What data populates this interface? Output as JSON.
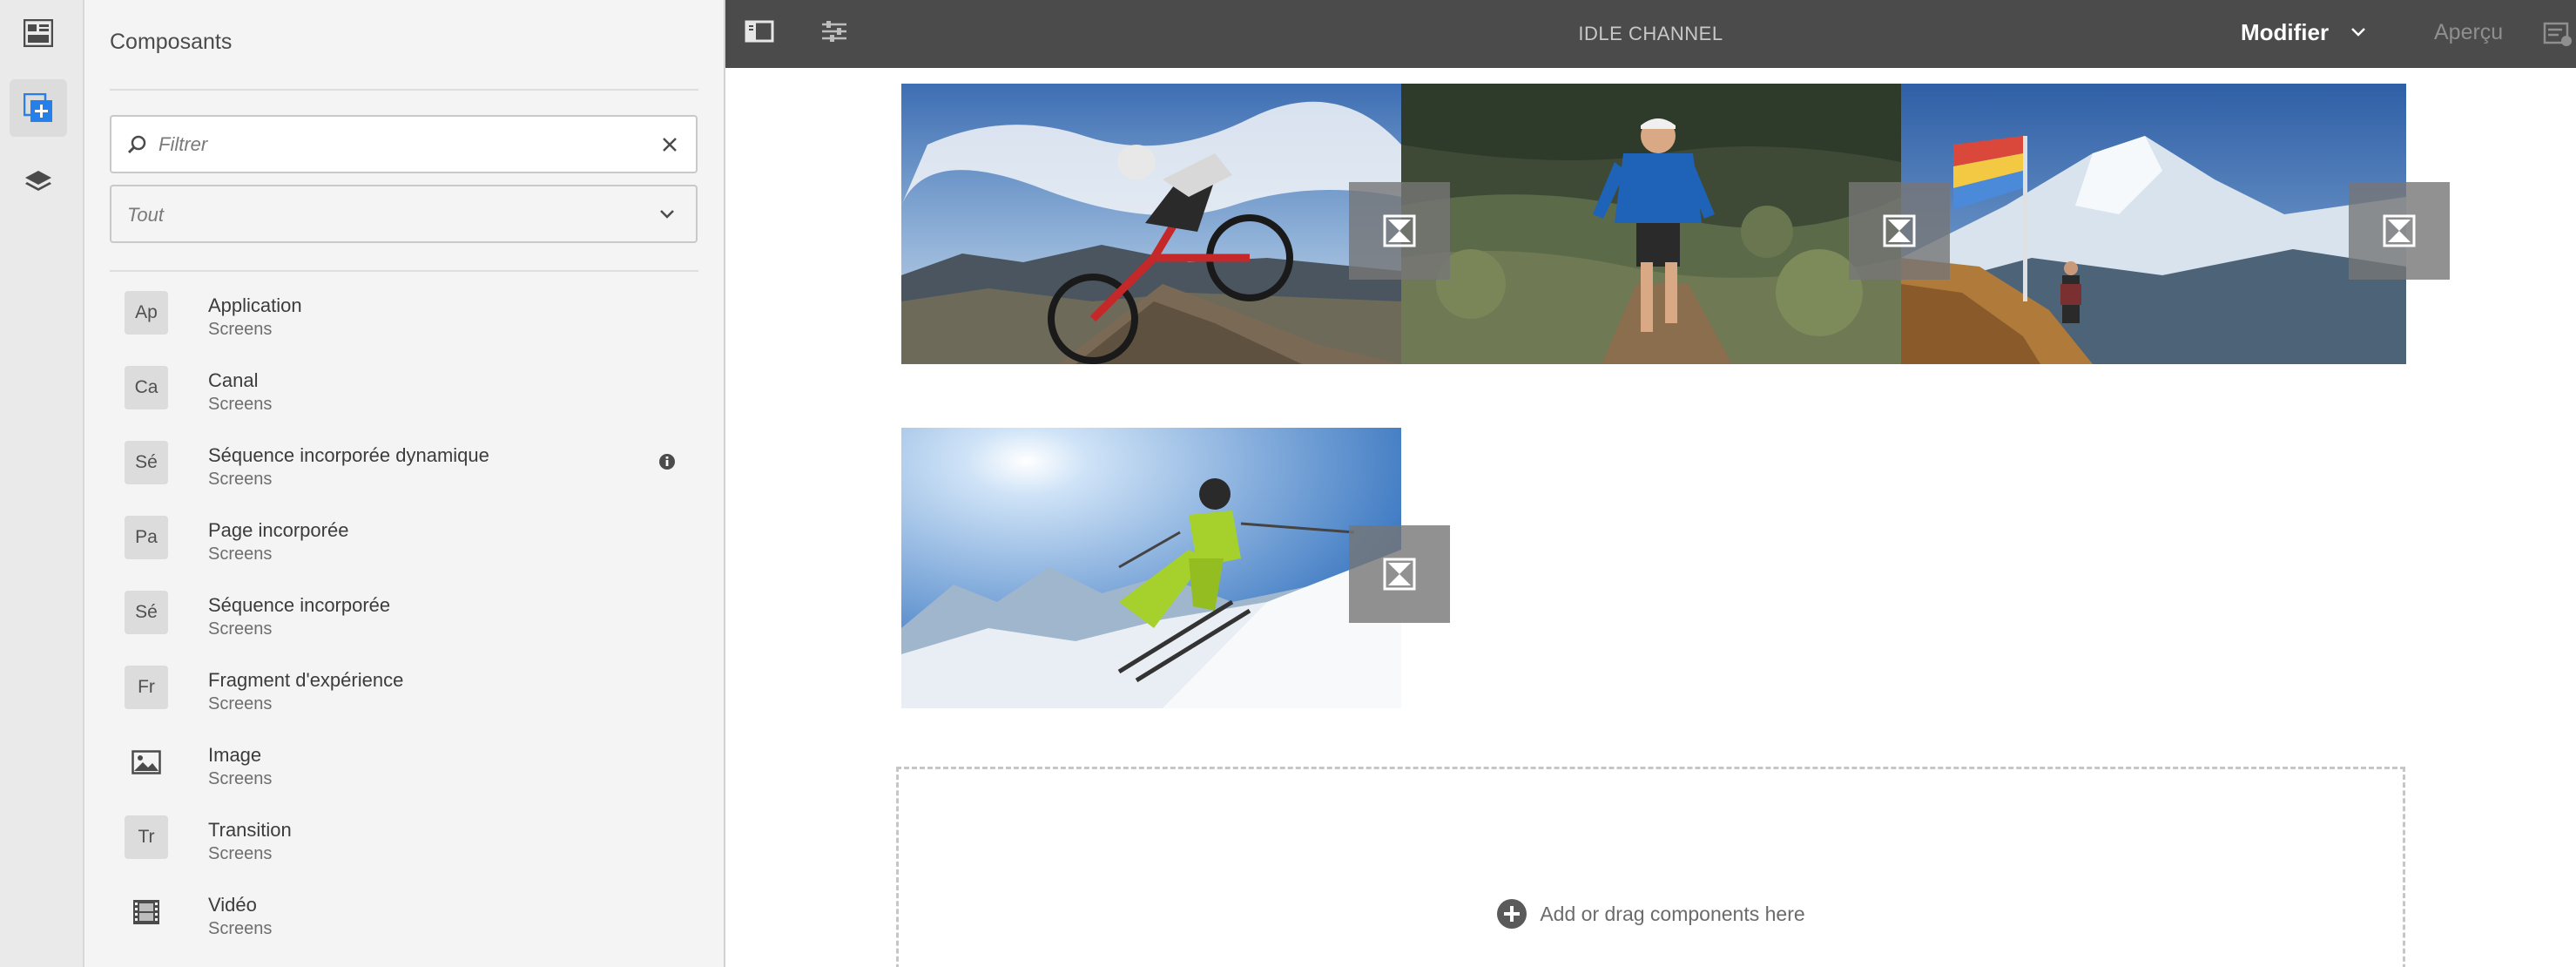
{
  "rail": {
    "items": [
      {
        "name": "assets-icon"
      },
      {
        "name": "components-icon",
        "active": true
      },
      {
        "name": "layers-icon"
      }
    ]
  },
  "panel": {
    "title": "Composants",
    "filter": {
      "value": "",
      "placeholder": "Filtrer"
    },
    "group_select": {
      "value": "Tout"
    },
    "components": [
      {
        "badge": "Ap",
        "name": "Application",
        "group": "Screens"
      },
      {
        "badge": "Ca",
        "name": "Canal",
        "group": "Screens"
      },
      {
        "badge": "Sé",
        "name": "Séquence incorporée dynamique",
        "group": "Screens",
        "info": true
      },
      {
        "badge": "Pa",
        "name": "Page incorporée",
        "group": "Screens"
      },
      {
        "badge": "Sé",
        "name": "Séquence incorporée",
        "group": "Screens"
      },
      {
        "badge": "Fr",
        "name": "Fragment d'expérience",
        "group": "Screens"
      },
      {
        "badge": "",
        "icon": "image-icon",
        "name": "Image",
        "group": "Screens"
      },
      {
        "badge": "Tr",
        "name": "Transition",
        "group": "Screens"
      },
      {
        "badge": "",
        "icon": "film-icon",
        "name": "Vidéo",
        "group": "Screens"
      }
    ]
  },
  "topbar": {
    "title": "IDLE CHANNEL",
    "mode": "Modifier",
    "preview": "Aperçu"
  },
  "canvas": {
    "images": [
      {
        "name": "mountain-biker-image",
        "subject": "mountain biker"
      },
      {
        "name": "trail-runner-image",
        "subject": "trail runner"
      },
      {
        "name": "mountain-hiker-image",
        "subject": "hiker with prayer flags"
      },
      {
        "name": "skier-image",
        "subject": "skier"
      }
    ],
    "dropzone_text": "Add or drag components here"
  },
  "colors": {
    "topbar": "#4b4b4b",
    "panel": "#f4f4f4",
    "rail": "#eaeaea",
    "accent": "#2680eb"
  }
}
